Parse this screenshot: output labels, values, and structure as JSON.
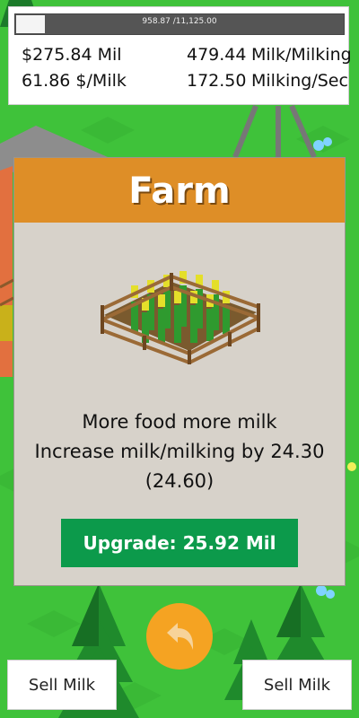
{
  "hud": {
    "progress_text": "958.87 /11,125.00",
    "progress_fraction": 0.0862,
    "money": "$275.84 Mil",
    "price": "61.86 $/Milk",
    "per_milking_value": "479.44",
    "per_milking_label": "Milk/Milking",
    "per_sec_value": "172.50",
    "per_sec_label": "Milking/Sec"
  },
  "panel": {
    "title": "Farm",
    "line1": "More food more milk",
    "line2": "Increase milk/milking by 24.30",
    "line3": "(24.60)",
    "upgrade_label": "Upgrade: 25.92 Mil"
  },
  "buttons": {
    "sell_left": "Sell Milk",
    "sell_right": "Sell Milk",
    "back_icon": "back-arrow-icon"
  },
  "colors": {
    "header": "#de8e27",
    "upgrade": "#0c9a4b",
    "back": "#f5a322",
    "grass": "#3fc23a"
  }
}
